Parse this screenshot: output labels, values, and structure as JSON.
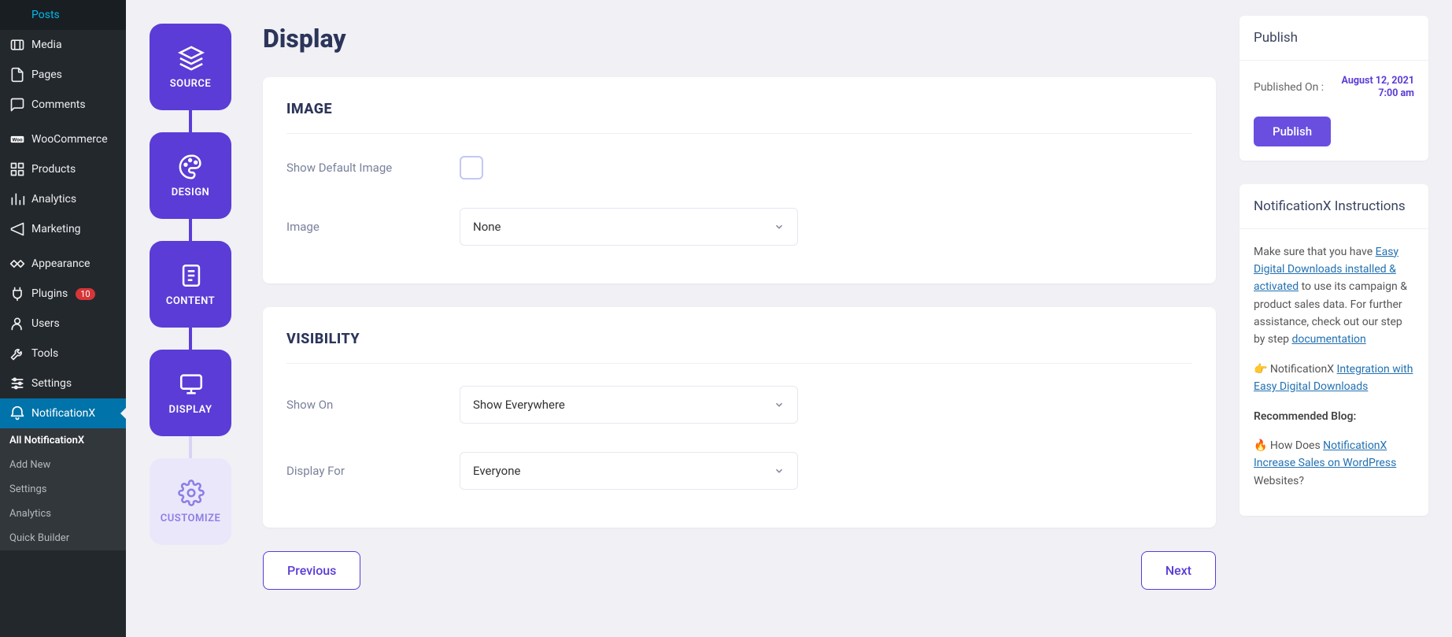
{
  "sidebar": {
    "items": [
      {
        "icon": "pin",
        "label": "Posts"
      },
      {
        "icon": "media",
        "label": "Media"
      },
      {
        "icon": "page",
        "label": "Pages"
      },
      {
        "icon": "comment",
        "label": "Comments"
      },
      {
        "sep": true
      },
      {
        "icon": "woo",
        "label": "WooCommerce"
      },
      {
        "icon": "products",
        "label": "Products"
      },
      {
        "icon": "analytics",
        "label": "Analytics"
      },
      {
        "icon": "marketing",
        "label": "Marketing"
      },
      {
        "sep": true
      },
      {
        "icon": "appearance",
        "label": "Appearance"
      },
      {
        "icon": "plugins",
        "label": "Plugins",
        "badge": "10"
      },
      {
        "icon": "users",
        "label": "Users"
      },
      {
        "icon": "tools",
        "label": "Tools"
      },
      {
        "icon": "settings",
        "label": "Settings"
      },
      {
        "icon": "notx",
        "label": "NotificationX",
        "active": true
      }
    ],
    "submenu": [
      {
        "label": "All NotificationX",
        "active": true
      },
      {
        "label": "Add New"
      },
      {
        "label": "Settings"
      },
      {
        "label": "Analytics"
      },
      {
        "label": "Quick Builder"
      }
    ]
  },
  "steps": [
    {
      "key": "source",
      "label": "SOURCE",
      "icon": "layers"
    },
    {
      "key": "design",
      "label": "DESIGN",
      "icon": "palette"
    },
    {
      "key": "content",
      "label": "CONTENT",
      "icon": "doc"
    },
    {
      "key": "display",
      "label": "DISPLAY",
      "icon": "monitor",
      "current": true
    },
    {
      "key": "customize",
      "label": "CUSTOMIZE",
      "icon": "gear",
      "future": true
    }
  ],
  "page": {
    "title": "Display"
  },
  "sections": {
    "image": {
      "title": "IMAGE",
      "show_default_label": "Show Default Image",
      "image_label": "Image",
      "image_value": "None"
    },
    "visibility": {
      "title": "VISIBILITY",
      "show_on_label": "Show On",
      "show_on_value": "Show Everywhere",
      "display_for_label": "Display For",
      "display_for_value": "Everyone"
    }
  },
  "nav": {
    "previous": "Previous",
    "next": "Next"
  },
  "publish": {
    "header": "Publish",
    "published_on_label": "Published On :",
    "date_line1": "August 12, 2021",
    "date_line2": "7:00 am",
    "button": "Publish"
  },
  "instructions": {
    "header": "NotificationX Instructions",
    "text1_pre": "Make sure that you have ",
    "link1": "Easy Digital Downloads installed & activated",
    "text1_post": " to use its campaign & product sales data. For further assistance, check out our step by step ",
    "link2": "documentation",
    "text2_emoji": "👉",
    "text2_pre": " NotificationX ",
    "link3": "Integration with Easy Digital Downloads",
    "rec_title": "Recommended Blog:",
    "text3_emoji": "🔥",
    "text3_pre": " How Does ",
    "link4": "NotificationX Increase Sales on WordPress",
    "text3_post": " Websites?"
  }
}
